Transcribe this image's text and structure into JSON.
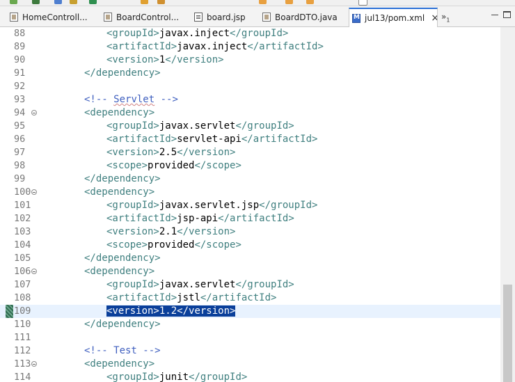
{
  "tabs": [
    {
      "label": "HomeControll...",
      "icon": "java-file-icon",
      "active": false
    },
    {
      "label": "BoardControl...",
      "icon": "java-file-icon",
      "active": false
    },
    {
      "label": "board.jsp",
      "icon": "jsp-file-icon",
      "active": false
    },
    {
      "label": "BoardDTO.java",
      "icon": "java-file-icon",
      "active": false
    },
    {
      "label": "jul13/pom.xml",
      "icon": "maven-pom-icon",
      "active": true,
      "close": "×"
    }
  ],
  "overflow": {
    "symbol": "»",
    "count": "1"
  },
  "editor": {
    "lines": [
      {
        "n": "88",
        "tokens": [
          [
            "tag",
            "<groupId>"
          ],
          [
            "txt",
            "javax.inject"
          ],
          [
            "tag",
            "</groupId>"
          ]
        ],
        "indent": 3
      },
      {
        "n": "89",
        "tokens": [
          [
            "tag",
            "<artifactId>"
          ],
          [
            "txt",
            "javax.inject"
          ],
          [
            "tag",
            "</artifactId>"
          ]
        ],
        "indent": 3
      },
      {
        "n": "90",
        "tokens": [
          [
            "tag",
            "<version>"
          ],
          [
            "txt",
            "1"
          ],
          [
            "tag",
            "</version>"
          ]
        ],
        "indent": 3
      },
      {
        "n": "91",
        "tokens": [
          [
            "tag",
            "</dependency>"
          ]
        ],
        "indent": 2
      },
      {
        "n": "92",
        "tokens": [],
        "indent": 0
      },
      {
        "n": "93",
        "tokens": [
          [
            "cmt",
            "<!-- "
          ],
          [
            "cmtsq",
            "Servlet"
          ],
          [
            "cmt",
            " -->"
          ]
        ],
        "indent": 2
      },
      {
        "n": "94",
        "tokens": [
          [
            "tag",
            "<dependency>"
          ]
        ],
        "indent": 2,
        "fold": true
      },
      {
        "n": "95",
        "tokens": [
          [
            "tag",
            "<groupId>"
          ],
          [
            "txt",
            "javax.servlet"
          ],
          [
            "tag",
            "</groupId>"
          ]
        ],
        "indent": 3
      },
      {
        "n": "96",
        "tokens": [
          [
            "tag",
            "<artifactId>"
          ],
          [
            "txt",
            "servlet-api"
          ],
          [
            "tag",
            "</artifactId>"
          ]
        ],
        "indent": 3
      },
      {
        "n": "97",
        "tokens": [
          [
            "tag",
            "<version>"
          ],
          [
            "txt",
            "2.5"
          ],
          [
            "tag",
            "</version>"
          ]
        ],
        "indent": 3
      },
      {
        "n": "98",
        "tokens": [
          [
            "tag",
            "<scope>"
          ],
          [
            "txt",
            "provided"
          ],
          [
            "tag",
            "</scope>"
          ]
        ],
        "indent": 3
      },
      {
        "n": "99",
        "tokens": [
          [
            "tag",
            "</dependency>"
          ]
        ],
        "indent": 2
      },
      {
        "n": "100",
        "tokens": [
          [
            "tag",
            "<dependency>"
          ]
        ],
        "indent": 2,
        "fold": true
      },
      {
        "n": "101",
        "tokens": [
          [
            "tag",
            "<groupId>"
          ],
          [
            "txt",
            "javax.servlet.jsp"
          ],
          [
            "tag",
            "</groupId>"
          ]
        ],
        "indent": 3
      },
      {
        "n": "102",
        "tokens": [
          [
            "tag",
            "<artifactId>"
          ],
          [
            "txt",
            "jsp-api"
          ],
          [
            "tag",
            "</artifactId>"
          ]
        ],
        "indent": 3
      },
      {
        "n": "103",
        "tokens": [
          [
            "tag",
            "<version>"
          ],
          [
            "txt",
            "2.1"
          ],
          [
            "tag",
            "</version>"
          ]
        ],
        "indent": 3
      },
      {
        "n": "104",
        "tokens": [
          [
            "tag",
            "<scope>"
          ],
          [
            "txt",
            "provided"
          ],
          [
            "tag",
            "</scope>"
          ]
        ],
        "indent": 3
      },
      {
        "n": "105",
        "tokens": [
          [
            "tag",
            "</dependency>"
          ]
        ],
        "indent": 2
      },
      {
        "n": "106",
        "tokens": [
          [
            "tag",
            "<dependency>"
          ]
        ],
        "indent": 2,
        "fold": true
      },
      {
        "n": "107",
        "tokens": [
          [
            "tag",
            "<groupId>"
          ],
          [
            "txt",
            "javax.servlet"
          ],
          [
            "tag",
            "</groupId>"
          ]
        ],
        "indent": 3
      },
      {
        "n": "108",
        "tokens": [
          [
            "tag",
            "<artifactId>"
          ],
          [
            "txt",
            "jstl"
          ],
          [
            "tag",
            "</artifactId>"
          ]
        ],
        "indent": 3
      },
      {
        "n": "109",
        "tokens": [
          [
            "tag",
            "<version>"
          ],
          [
            "txt",
            "1.2"
          ],
          [
            "tag",
            "</version>"
          ]
        ],
        "indent": 3,
        "selected": true,
        "current": true,
        "changed": true
      },
      {
        "n": "110",
        "tokens": [
          [
            "tag",
            "</dependency>"
          ]
        ],
        "indent": 2
      },
      {
        "n": "111",
        "tokens": [],
        "indent": 0
      },
      {
        "n": "112",
        "tokens": [
          [
            "cmt",
            "<!-- Test -->"
          ]
        ],
        "indent": 2
      },
      {
        "n": "113",
        "tokens": [
          [
            "tag",
            "<dependency>"
          ]
        ],
        "indent": 2,
        "fold": true
      },
      {
        "n": "114",
        "tokens": [
          [
            "tag",
            "<groupId>"
          ],
          [
            "txt",
            "junit"
          ],
          [
            "tag",
            "</groupId>"
          ]
        ],
        "indent": 3
      }
    ]
  }
}
